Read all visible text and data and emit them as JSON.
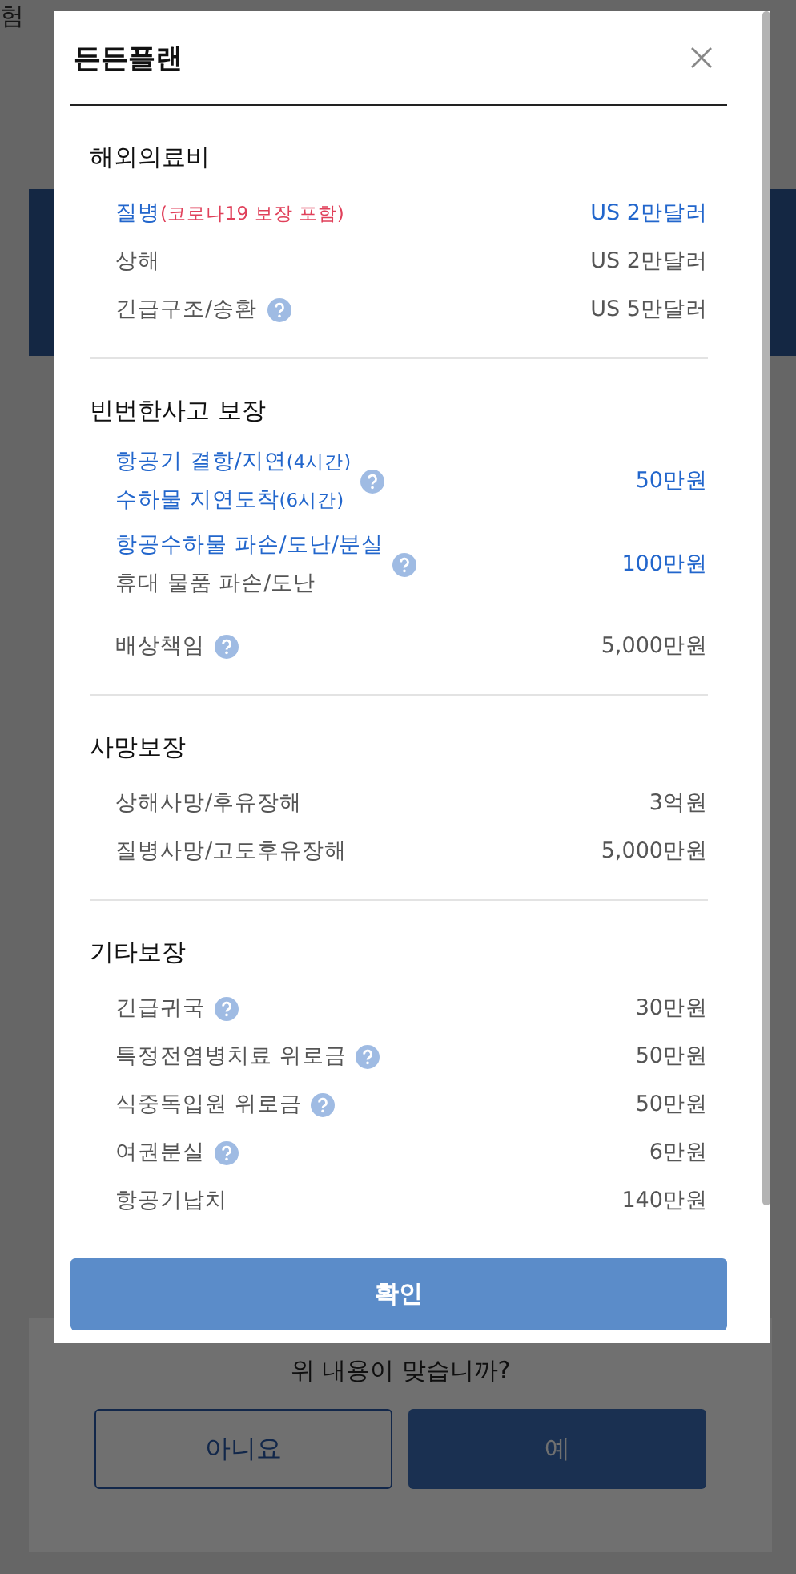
{
  "background_page": {
    "tab_fragment": "험",
    "question": "위 내용이 맞습니까?",
    "buttons": [
      {
        "label": "아니요",
        "kind": "outline"
      },
      {
        "label": "예",
        "kind": "solid"
      }
    ]
  },
  "modal": {
    "title": "든든플랜",
    "sections": [
      {
        "heading": "해외의료비",
        "items": [
          {
            "lines": [
              {
                "text": "질병",
                "note": "(코로나19 보장 포함)",
                "note_alert": true
              }
            ],
            "help": false,
            "value": "US 2만달러",
            "highlighted": true
          },
          {
            "lines": [
              {
                "text": "상해"
              }
            ],
            "help": false,
            "value": "US 2만달러",
            "highlighted": false
          },
          {
            "lines": [
              {
                "text": "긴급구조/송환"
              }
            ],
            "help": true,
            "value": "US 5만달러",
            "highlighted": false
          }
        ]
      },
      {
        "heading": "빈번한사고 보장",
        "items": [
          {
            "lines": [
              {
                "text": "항공기 결항/지연",
                "note": "(4시간)",
                "note_alert": false
              },
              {
                "text": "수하물 지연도착",
                "note": "(6시간)",
                "note_alert": false
              }
            ],
            "help": true,
            "value": "50만원",
            "highlighted": true
          },
          {
            "lines": [
              {
                "text": "항공수하물 파손/도난/분실"
              },
              {
                "text": "휴대 물품 파손/도난",
                "plain": true
              }
            ],
            "help": true,
            "value": "100만원",
            "highlighted": true
          },
          {
            "lines": [
              {
                "text": "배상책임"
              }
            ],
            "help": true,
            "value": "5,000만원",
            "highlighted": false
          }
        ]
      },
      {
        "heading": "사망보장",
        "items": [
          {
            "lines": [
              {
                "text": "상해사망/후유장해"
              }
            ],
            "help": false,
            "value": "3억원",
            "highlighted": false
          },
          {
            "lines": [
              {
                "text": "질병사망/고도후유장해"
              }
            ],
            "help": false,
            "value": "5,000만원",
            "highlighted": false
          }
        ]
      },
      {
        "heading": "기타보장",
        "items": [
          {
            "lines": [
              {
                "text": "긴급귀국"
              }
            ],
            "help": true,
            "value": "30만원",
            "highlighted": false
          },
          {
            "lines": [
              {
                "text": "특정전염병치료 위로금"
              }
            ],
            "help": true,
            "value": "50만원",
            "highlighted": false
          },
          {
            "lines": [
              {
                "text": "식중독입원 위로금"
              }
            ],
            "help": true,
            "value": "50만원",
            "highlighted": false
          },
          {
            "lines": [
              {
                "text": "여권분실"
              }
            ],
            "help": true,
            "value": "6만원",
            "highlighted": false
          },
          {
            "lines": [
              {
                "text": "항공기납치"
              }
            ],
            "help": false,
            "value": "140만원",
            "highlighted": false
          }
        ]
      }
    ],
    "confirm": "확인"
  }
}
